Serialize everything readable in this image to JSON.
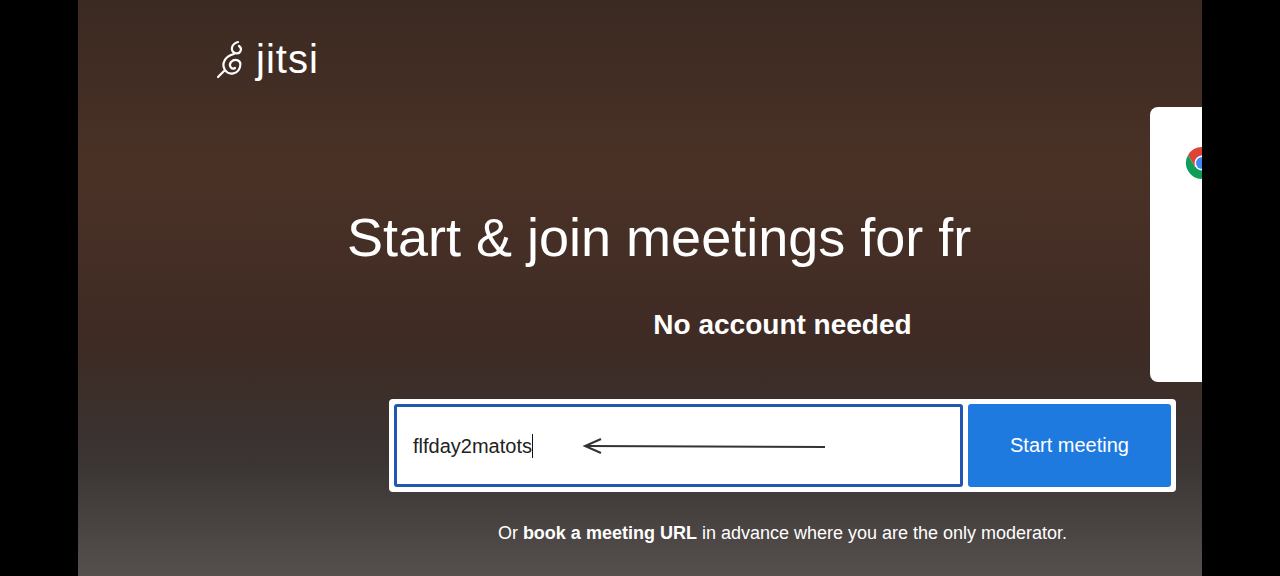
{
  "logo": {
    "text": "jitsi"
  },
  "hero": {
    "title": "Start & join meetings for fr",
    "subtitle": "No account needed"
  },
  "meeting_form": {
    "value": "flfday2matots",
    "focused": true,
    "button": "Start meeting"
  },
  "footer": {
    "prefix": "Or ",
    "link": "book a meeting URL",
    "suffix": " in advance where you are the only moderator."
  }
}
